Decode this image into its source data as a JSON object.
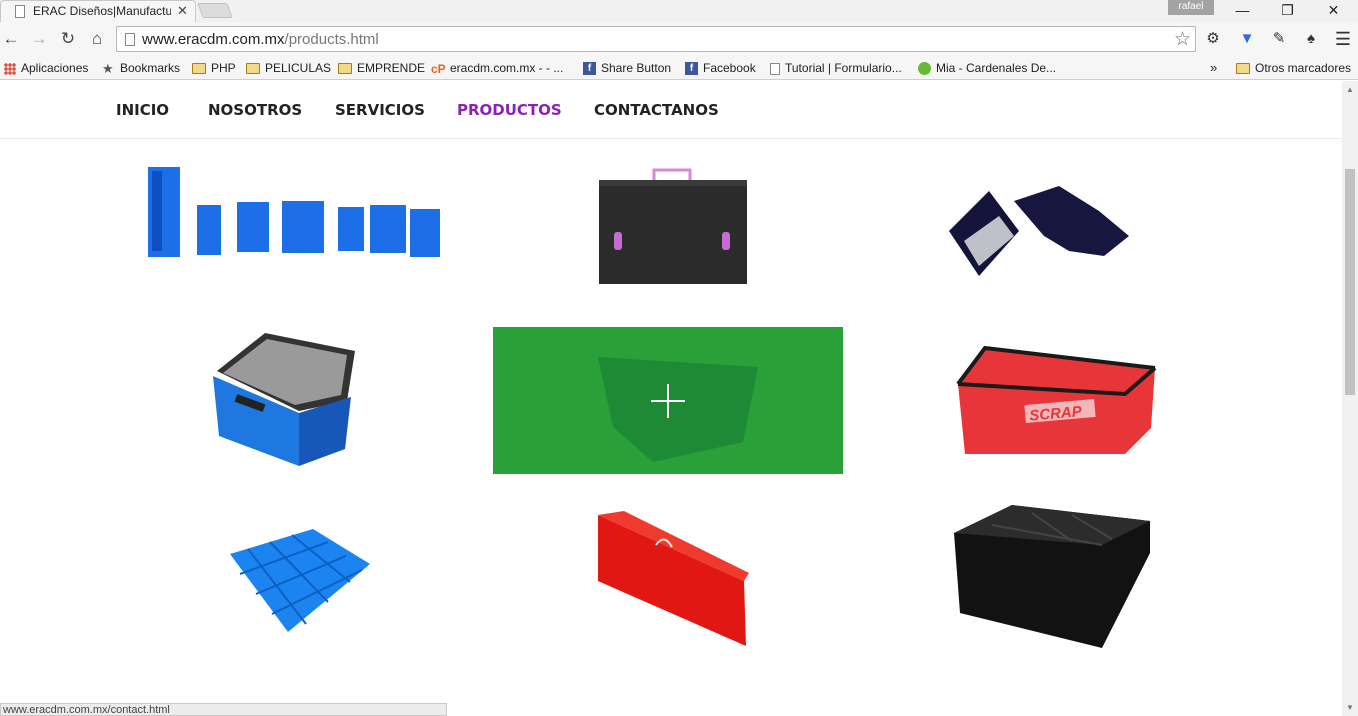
{
  "window": {
    "tab_title": "ERAC Diseños|Manufactur",
    "profile": "rafael",
    "minimize": "—",
    "restore": "❐",
    "close": "✕"
  },
  "toolbar": {
    "url_host": "www.eracdm.com.mx",
    "url_path": "/products.html"
  },
  "bookmarks": [
    {
      "label": "Aplicaciones",
      "icon": "apps-icon"
    },
    {
      "label": "Bookmarks",
      "icon": "star-icon"
    },
    {
      "label": "PHP",
      "icon": "folder-icon"
    },
    {
      "label": "PELICULAS",
      "icon": "folder-icon"
    },
    {
      "label": "EMPRENDE",
      "icon": "folder-icon"
    },
    {
      "label": "eracdm.com.mx - - ...",
      "icon": "cpanel-icon"
    },
    {
      "label": "Share Button",
      "icon": "facebook-icon"
    },
    {
      "label": "Facebook",
      "icon": "facebook-icon"
    },
    {
      "label": "Tutorial | Formulario...",
      "icon": "page-icon"
    },
    {
      "label": "Mia - Cardenales De...",
      "icon": "spotify-icon"
    }
  ],
  "bookmarks_overflow": "»",
  "other_bookmarks": "Otros marcadores",
  "nav": {
    "items": [
      "INICIO",
      "NOSOTROS",
      "SERVICIOS",
      "PRODUCTOS",
      "CONTACTANOS"
    ],
    "active": "PRODUCTOS",
    "active_color": "#8a22b8"
  },
  "products": [
    {
      "name": "blue-bins-set"
    },
    {
      "name": "black-briefcase"
    },
    {
      "name": "dark-folding-boxes"
    },
    {
      "name": "blue-box-dividers"
    },
    {
      "name": "green-tote-hover"
    },
    {
      "name": "red-scrap-bin"
    },
    {
      "name": "blue-grid-divider"
    },
    {
      "name": "red-case"
    },
    {
      "name": "black-divided-crate"
    }
  ],
  "overlay_color": "#2aa039",
  "status_url": "www.eracdm.com.mx/contact.html"
}
